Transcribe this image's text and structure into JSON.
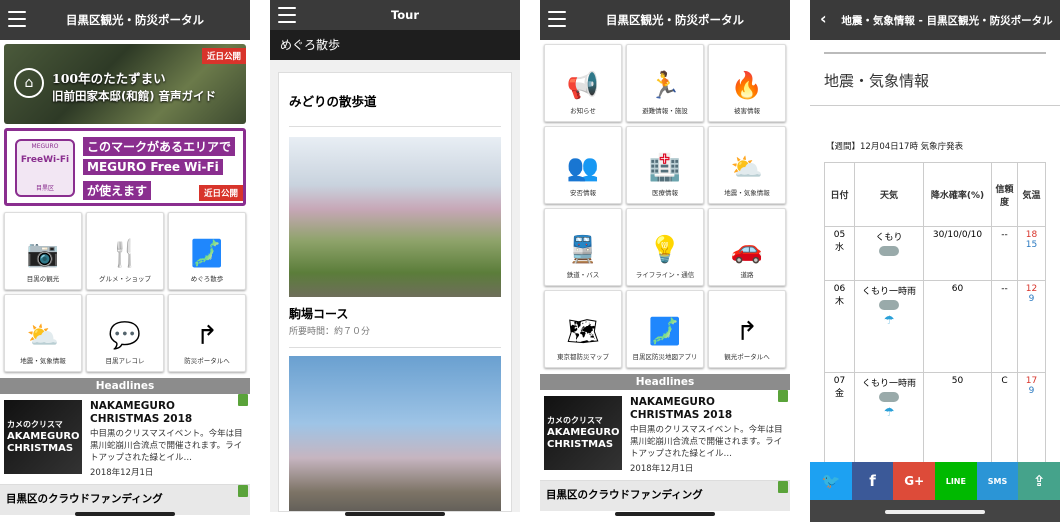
{
  "phone1": {
    "title": "目黒区観光・防災ポータル",
    "banner1": {
      "line1": "100年のたたずまい",
      "line2": "旧前田家本邸(和館) 音声ガイド",
      "tag": "近日公開"
    },
    "banner2": {
      "badge1": "MEGURO",
      "badge2": "FreeWi-Fi",
      "badge3": "目黒区",
      "line1": "このマークがあるエリアで",
      "line2": "MEGURO Free Wi-Fi",
      "line3": "が使えます",
      "tag": "近日公開"
    },
    "tiles": [
      {
        "label": "目黒の観光",
        "glyph": "📷"
      },
      {
        "label": "グルメ・ショップ",
        "glyph": "🍴"
      },
      {
        "label": "めぐろ散歩",
        "glyph": "🗾"
      },
      {
        "label": "地震・気象情報",
        "glyph": "⛅"
      },
      {
        "label": "目黒アレコレ",
        "glyph": "💬"
      },
      {
        "label": "防災ポータルへ",
        "glyph": "↱"
      }
    ],
    "headlines": "Headlines",
    "news": {
      "thumb_line1": "カメのクリスマ",
      "thumb_line2": "AKAMEGURO",
      "thumb_line3": "CHRISTMAS",
      "title": "NAKAMEGURO CHRISTMAS 2018",
      "desc": "中目黒のクリスマスイベント。今年は目黒川蛇崩川合流点で開催されます。ライトアップされた緑とイル…",
      "date": "2018年12月1日"
    },
    "crowd": "目黒区のクラウドファンディング"
  },
  "phone2": {
    "title": "Tour",
    "subtitle": "めぐろ散歩",
    "card_title": "みどりの散歩道",
    "course": "駒場コース",
    "time": "所要時間：約７０分"
  },
  "phone3": {
    "title": "目黒区観光・防災ポータル",
    "tiles": [
      {
        "label": "お知らせ",
        "glyph": "📢"
      },
      {
        "label": "避難情報・施設",
        "glyph": "🏃"
      },
      {
        "label": "被害情報",
        "glyph": "🔥"
      },
      {
        "label": "安否情報",
        "glyph": "👥"
      },
      {
        "label": "医療情報",
        "glyph": "🏥"
      },
      {
        "label": "地震・気象情報",
        "glyph": "⛅"
      },
      {
        "label": "鉄道・バス",
        "glyph": "🚆"
      },
      {
        "label": "ライフライン・通信",
        "glyph": "💡"
      },
      {
        "label": "道路",
        "glyph": "🚗"
      },
      {
        "label": "東京都防災マップ",
        "glyph": "🗺"
      },
      {
        "label": "目黒区防災地図アプリ",
        "glyph": "🗾"
      },
      {
        "label": "観光ポータルへ",
        "glyph": "↱"
      }
    ],
    "headlines": "Headlines",
    "news": {
      "thumb_line1": "カメのクリスマ",
      "thumb_line2": "AKAMEGURO",
      "thumb_line3": "CHRISTMAS",
      "title": "NAKAMEGURO CHRISTMAS 2018",
      "desc": "中目黒のクリスマスイベント。今年は目黒川蛇崩川合流点で開催されます。ライトアップされた緑とイル…",
      "date": "2018年12月1日"
    },
    "crowd": "目黒区のクラウドファンディング"
  },
  "phone4": {
    "title": "地震・気象情報 - 目黒区観光・防災ポータル",
    "page_title": "地震・気象情報",
    "subtitle": "【週間】12月04日17時 気象庁発表",
    "headers": {
      "date": "日付",
      "weather": "天気",
      "rain": "降水確率(%)",
      "reliability": "信頼度",
      "temp": "気温"
    },
    "rows": [
      {
        "day": "05",
        "dow": "水",
        "weather": "くもり",
        "rain": "30/10/0/10",
        "rel": "--",
        "hi": "18",
        "lo": "15"
      },
      {
        "day": "06",
        "dow": "木",
        "weather": "くもり一時雨",
        "rain": "60",
        "rel": "--",
        "hi": "12",
        "lo": "9"
      },
      {
        "day": "07",
        "dow": "金",
        "weather": "くもり一時雨",
        "rain": "50",
        "rel": "C",
        "hi": "17",
        "lo": "9"
      }
    ],
    "share": [
      {
        "name": "twitter",
        "glyph": "🐦",
        "color": "#1da1f2"
      },
      {
        "name": "facebook",
        "glyph": "f",
        "color": "#3b5998"
      },
      {
        "name": "google-plus",
        "glyph": "G+",
        "color": "#dd4b39"
      },
      {
        "name": "line",
        "glyph": "LINE",
        "color": "#00b900"
      },
      {
        "name": "sms",
        "glyph": "SMS",
        "color": "#2b95d6"
      },
      {
        "name": "share",
        "glyph": "⇪",
        "color": "#45a38b"
      }
    ]
  }
}
